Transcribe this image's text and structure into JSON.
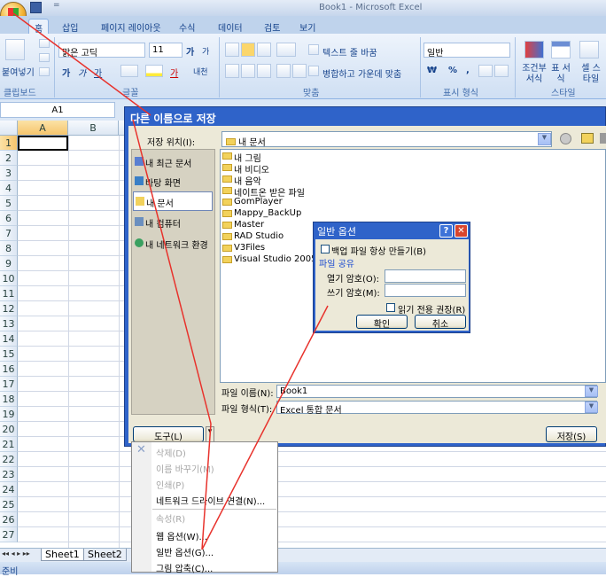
{
  "app": {
    "title": "Book1 - Microsoft Excel",
    "qat_dropdown": "="
  },
  "ribbon": {
    "tabs": [
      "홈",
      "삽입",
      "페이지 레이아웃",
      "수식",
      "데이터",
      "검토",
      "보기"
    ],
    "paste_label": "붙여넣기",
    "font_name": "맑은 고딕",
    "font_size": "11",
    "increase_font": "가",
    "decrease_font": "가",
    "bold": "가",
    "italic": "가",
    "underline": "가",
    "font_color": "가",
    "phonetic": "내천",
    "wrap_text": "텍스트 줄 바꿈",
    "merge_center": "병합하고 가운데 맞춤",
    "number_format": "일반",
    "currency": "₩",
    "percent": "%",
    "comma": ",",
    "conditional_format": "조건부 서식",
    "table_format": "표 서식",
    "cell_style": "셀 스타일",
    "groups": {
      "clipboard": "클립보드",
      "font": "글꼴",
      "alignment": "맞춤",
      "number": "표시 형식",
      "style": "스타일"
    }
  },
  "formula_bar": {
    "name_box": "A1"
  },
  "sheet": {
    "columns": [
      "A",
      "B"
    ],
    "rows": [
      "1",
      "2",
      "3",
      "4",
      "5",
      "6",
      "7",
      "8",
      "9",
      "10",
      "11",
      "12",
      "13",
      "14",
      "15",
      "16",
      "17",
      "18",
      "19",
      "20",
      "21",
      "22",
      "23",
      "24",
      "25",
      "26",
      "27"
    ],
    "tabs": [
      "Sheet1",
      "Sheet2"
    ],
    "status": "준비"
  },
  "save_dialog": {
    "title": "다른 이름으로 저장",
    "location_label": "저장 위치(I):",
    "location_value": "내 문서",
    "places": [
      "내 최근 문서",
      "바탕 화면",
      "내 문서",
      "내 컴퓨터",
      "내 네트워크 환경"
    ],
    "files": [
      "내 그림",
      "내 비디오",
      "내 음악",
      "네이트온 받은 파일",
      "GomPlayer",
      "Mappy_BackUp",
      "Master",
      "RAD Studio",
      "V3Files",
      "Visual Studio 2005"
    ],
    "filename_label": "파일 이름(N):",
    "filename_value": "Book1",
    "filetype_label": "파일 형식(T):",
    "filetype_value": "Excel 통합 문서",
    "tools_button": "도구(L)",
    "save_button": "저장(S)"
  },
  "tools_menu": {
    "items": [
      {
        "label": "삭제(D)",
        "enabled": false
      },
      {
        "label": "이름 바꾸기(M)",
        "enabled": false
      },
      {
        "label": "인쇄(P)",
        "enabled": false
      },
      {
        "label": "네트워크 드라이브 연결(N)...",
        "enabled": true
      },
      {
        "label": "속성(R)",
        "enabled": false
      },
      {
        "label": "웹 옵션(W)...",
        "enabled": true
      },
      {
        "label": "일반 옵션(G)...",
        "enabled": true
      },
      {
        "label": "그림 압축(C)...",
        "enabled": true
      }
    ]
  },
  "general_options": {
    "title": "일반 옵션",
    "help": "?",
    "close": "✕",
    "backup_label": "백업 파일 항상 만들기(B)",
    "sharing_header": "파일 공유",
    "open_password_label": "열기 암호(O):",
    "modify_password_label": "쓰기 암호(M):",
    "readonly_label": "읽기 전용 권장(R)",
    "ok": "확인",
    "cancel": "취소"
  },
  "colors": {
    "annotation_arrow": "#e8322c",
    "dialog_title": "#2f63c9",
    "dialog_body": "#ece9d8"
  }
}
